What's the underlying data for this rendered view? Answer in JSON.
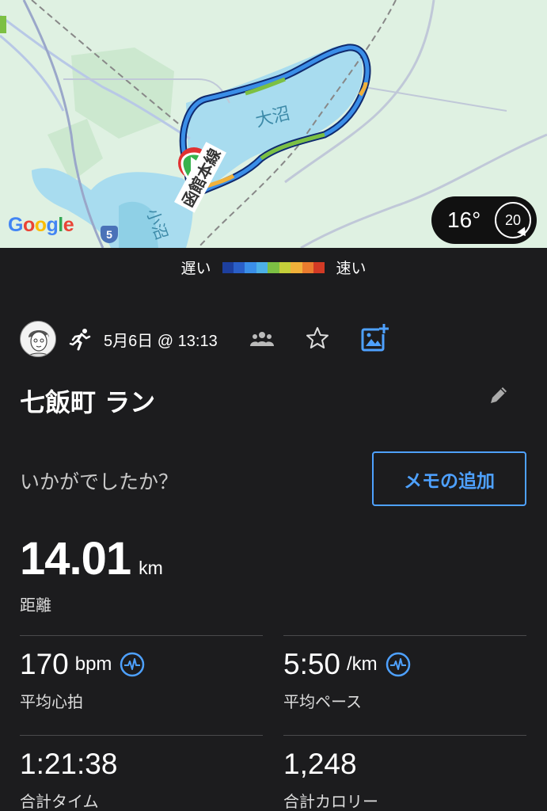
{
  "map": {
    "lake_label": "大沼",
    "lake2_label": "小沼",
    "rail_label": "函館本線",
    "route_shield": "5",
    "google_logo": [
      "G",
      "o",
      "o",
      "g",
      "l",
      "e"
    ]
  },
  "weather": {
    "temperature": "16°",
    "wind": "20"
  },
  "legend": {
    "slow": "遅い",
    "fast": "速い",
    "colors": [
      "#1d3f9e",
      "#2a5fc8",
      "#3a8ee8",
      "#4cb0e6",
      "#7cc043",
      "#c4cf3a",
      "#f1b13a",
      "#ea7b2e",
      "#d23a25"
    ]
  },
  "activity": {
    "date": "5月6日 @ 13:13",
    "title": "七飯町 ラン",
    "icons": [
      "avatar",
      "running-icon",
      "group-icon",
      "star-icon",
      "add-photo-icon",
      "edit-icon"
    ]
  },
  "feedback": {
    "prompt": "いかがでしたか？",
    "memo_button": "メモの追加"
  },
  "stats": {
    "distance": {
      "value": "14.01",
      "unit": "km",
      "label": "距離"
    },
    "heart_rate": {
      "value": "170",
      "unit": "bpm",
      "label": "平均心拍"
    },
    "pace": {
      "value": "5:50",
      "unit": "/km",
      "label": "平均ペース"
    },
    "time": {
      "value": "1:21:38",
      "label": "合計タイム"
    },
    "calories": {
      "value": "1,248",
      "label": "合計カロリー"
    }
  },
  "colors": {
    "background": "#1c1c1e",
    "accent": "#4ea1ff",
    "map_water": "#a8dcef",
    "map_land": "#dff1e2",
    "start_marker": "#37b24d"
  }
}
